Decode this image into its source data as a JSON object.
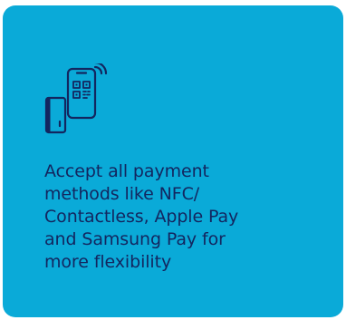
{
  "card": {
    "background": "#0aaad8",
    "icon": "nfc-qr-payment-icon",
    "text_color": "#13265f",
    "description": "Accept all payment\nmethods like NFC/\nContactless, Apple Pay\nand Samsung Pay for\nmore flexibility"
  }
}
